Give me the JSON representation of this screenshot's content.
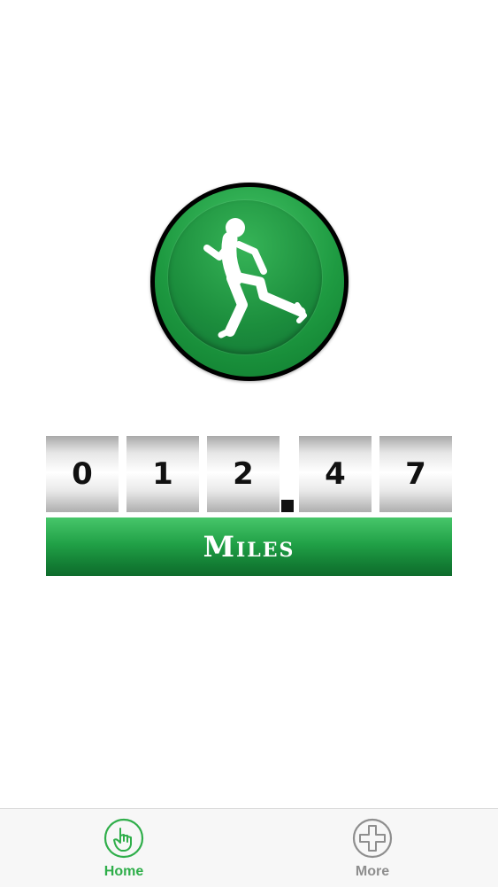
{
  "odometer": {
    "digits": [
      "0",
      "1",
      "2",
      "4",
      "7"
    ],
    "units_label": "Miles"
  },
  "runner_button": {
    "icon": "running-figure-icon"
  },
  "tab_bar": {
    "tabs": [
      {
        "label": "Home",
        "icon": "hand-pointer-icon",
        "active": true,
        "color": "#2fae4a"
      },
      {
        "label": "More",
        "icon": "plus-circle-icon",
        "active": false,
        "color": "#8e8e8e"
      }
    ]
  },
  "colors": {
    "accent": "#2fae4a",
    "bar_dark": "#0e6b2c",
    "inactive": "#8e8e8e"
  }
}
